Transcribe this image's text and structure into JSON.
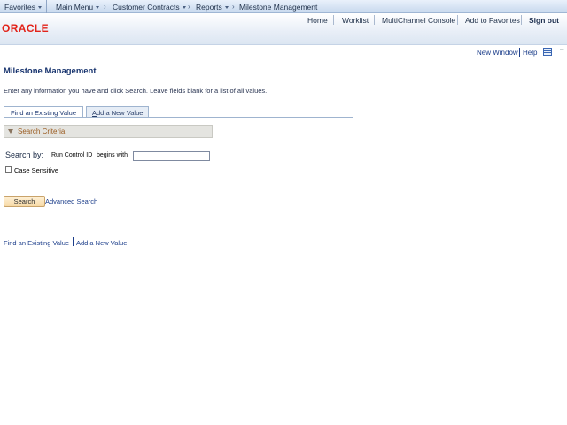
{
  "navbar": {
    "favorites": "Favorites",
    "main_menu": "Main Menu",
    "breadcrumb": [
      "Customer Contracts",
      "Reports",
      "Milestone Management"
    ]
  },
  "header": {
    "logo": "ORACLE",
    "links": [
      "Home",
      "Worklist",
      "MultiChannel Console",
      "Add to Favorites"
    ],
    "sign_out": "Sign out"
  },
  "utility": {
    "new_window": "New Window",
    "help": "Help",
    "icon": "customize-page-icon"
  },
  "page": {
    "title": "Milestone Management",
    "instructions": "Enter any information you have and click Search. Leave fields blank for a list of all values."
  },
  "tabs": {
    "active": "Find an Existing Value",
    "inactive_first": "A",
    "inactive_rest": "dd a New Value"
  },
  "criteria": {
    "label": "Search Criteria",
    "search_by": "Search by:",
    "field": "Run Control ID",
    "operator": "begins with",
    "value": "",
    "case_sensitive_label": "Case Sensitive",
    "case_sensitive_checked": false
  },
  "buttons": {
    "search": "Search",
    "advanced_search": "Advanced Search"
  },
  "bottom_links": {
    "find": "Find an Existing Value",
    "add": "Add a New Value"
  }
}
